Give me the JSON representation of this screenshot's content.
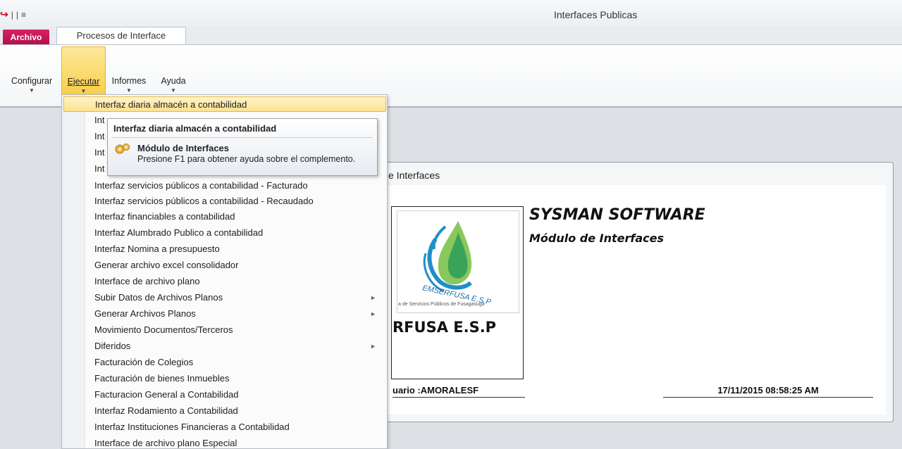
{
  "window": {
    "title": "Interfaces Publicas"
  },
  "tabs": {
    "archivo": "Archivo",
    "procesos": "Procesos de Interface"
  },
  "ribbon": {
    "configurar": "Configurar",
    "ejecutar": "Ejecutar",
    "informes": "Informes",
    "ayuda": "Ayuda"
  },
  "menu": {
    "items": [
      {
        "label": "Interfaz diaria almacén a contabilidad",
        "highlighted": true
      },
      {
        "label": "Int"
      },
      {
        "label": "Int"
      },
      {
        "label": "Int"
      },
      {
        "label": "Int"
      },
      {
        "label": "Interfaz servicios públicos a contabilidad - Facturado"
      },
      {
        "label": "Interfaz servicios públicos a contabilidad - Recaudado"
      },
      {
        "label": "Interfaz financiables a contabilidad"
      },
      {
        "label": "Interfaz Alumbrado Publico a contabilidad"
      },
      {
        "label": "Interfaz Nomina a presupuesto"
      },
      {
        "label": "Generar archivo excel consolidador"
      },
      {
        "label": "Interface de archivo plano"
      },
      {
        "label": "Subir Datos de Archivos Planos",
        "submenu": true
      },
      {
        "label": "Generar Archivos Planos",
        "submenu": true
      },
      {
        "label": "Movimiento Documentos/Terceros"
      },
      {
        "label": "Diferidos",
        "submenu": true
      },
      {
        "label": "Facturación de Colegios"
      },
      {
        "label": "Facturación de bienes Inmuebles"
      },
      {
        "label": "Facturacion General a Contabilidad"
      },
      {
        "label": "Interfaz Rodamiento a Contabilidad"
      },
      {
        "label": "Interfaz Instituciones Financieras a Contabilidad"
      },
      {
        "label": "Interface de archivo plano Especial"
      }
    ]
  },
  "tooltip": {
    "title": "Interfaz diaria almacén a contabilidad",
    "heading": "Módulo de Interfaces",
    "description": "Presione F1 para obtener ayuda sobre el complemento."
  },
  "inner": {
    "title": "e Interfaces",
    "brand": "SYSMAN SOFTWARE",
    "subtitle": "Módulo de Interfaces",
    "logo_text": "EMSERFUSA E.S.P",
    "logo_caption": "a de Servicios Públicos de Fusagasugá",
    "company": "RFUSA E.S.P",
    "user": "uario  :AMORALESF",
    "datetime": "17/11/2015 08:58:25 AM"
  },
  "icons": {
    "tooltip_icon": "gear-cluster-icon",
    "submenu_arrow": "chevron-right-icon",
    "dropdown_arrow": "chevron-down-icon"
  },
  "colors": {
    "archivo_tab": "#c8104f",
    "highlight": "#fde28c",
    "logo_blue": "#1f8fc9",
    "logo_green": "#7cc24a"
  }
}
